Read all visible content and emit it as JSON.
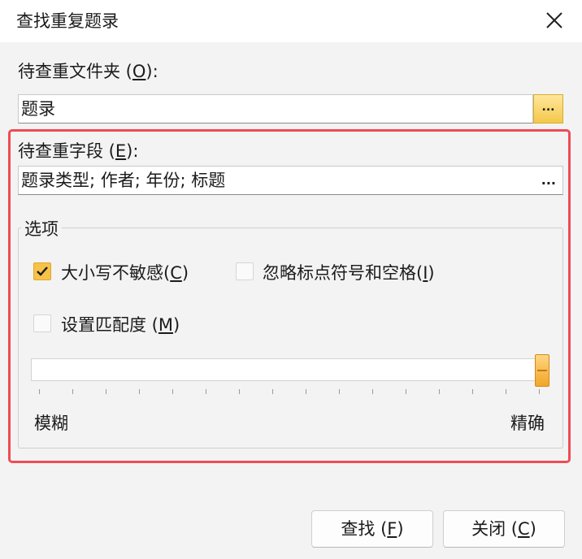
{
  "dialog": {
    "title": "查找重复题录"
  },
  "folder": {
    "label_text": "待查重文件夹 (",
    "label_key": "O",
    "label_end": "):",
    "value": "题录",
    "browse_label": "..."
  },
  "fields": {
    "label_text": "待查重字段 (",
    "label_key": "E",
    "label_end": "):",
    "value": "题录类型; 作者; 年份; 标题",
    "more_label": "..."
  },
  "options": {
    "group_label": "选项",
    "case_insensitive": {
      "label_text": "大小写不敏感(",
      "key": "C",
      "label_end": ")",
      "checked": true
    },
    "ignore_punct": {
      "label_text": "忽略标点符号和空格(",
      "key": "I",
      "label_end": ")",
      "checked": false
    },
    "match_degree": {
      "label_text": "设置匹配度 (",
      "key": "M",
      "label_end": ")",
      "checked": false
    }
  },
  "slider": {
    "min_label": "模糊",
    "max_label": "精确",
    "value_fraction": 1.0,
    "enabled": false
  },
  "buttons": {
    "find": {
      "text": "查找 (",
      "key": "F",
      "end": ")"
    },
    "close": {
      "text": "关闭 (",
      "key": "C",
      "end": ")"
    }
  },
  "colors": {
    "accent": "#f6c24a",
    "highlight_border": "#ef4b55"
  }
}
